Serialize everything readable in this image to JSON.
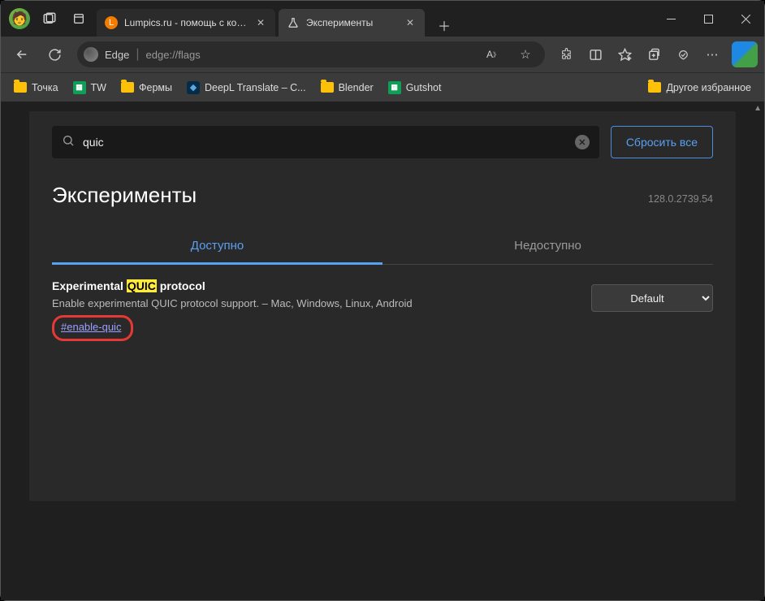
{
  "titlebar": {
    "tabs": [
      {
        "title": "Lumpics.ru - помощь с компьюте",
        "favicon": "orange"
      },
      {
        "title": "Эксперименты",
        "favicon": "flask"
      }
    ]
  },
  "addressbar": {
    "edge_label": "Edge",
    "url": "edge://flags"
  },
  "bookmarks": {
    "items": [
      {
        "type": "folder",
        "label": "Точка"
      },
      {
        "type": "sheet",
        "label": "TW"
      },
      {
        "type": "folder",
        "label": "Фермы"
      },
      {
        "type": "deepl",
        "label": "DeepL Translate – С..."
      },
      {
        "type": "folder",
        "label": "Blender"
      },
      {
        "type": "sheet",
        "label": "Gutshot"
      }
    ],
    "overflow_label": "Другое избранное"
  },
  "flags_page": {
    "search_value": "quic",
    "reset_label": "Сбросить все",
    "title": "Эксперименты",
    "version": "128.0.2739.54",
    "tab_available": "Доступно",
    "tab_unavailable": "Недоступно",
    "flag": {
      "title_pre": "Experimental ",
      "title_highlight": "QUIC",
      "title_post": " protocol",
      "desc": "Enable experimental QUIC protocol support. – Mac, Windows, Linux, Android",
      "hash": "#enable-quic",
      "select_value": "Default"
    }
  }
}
